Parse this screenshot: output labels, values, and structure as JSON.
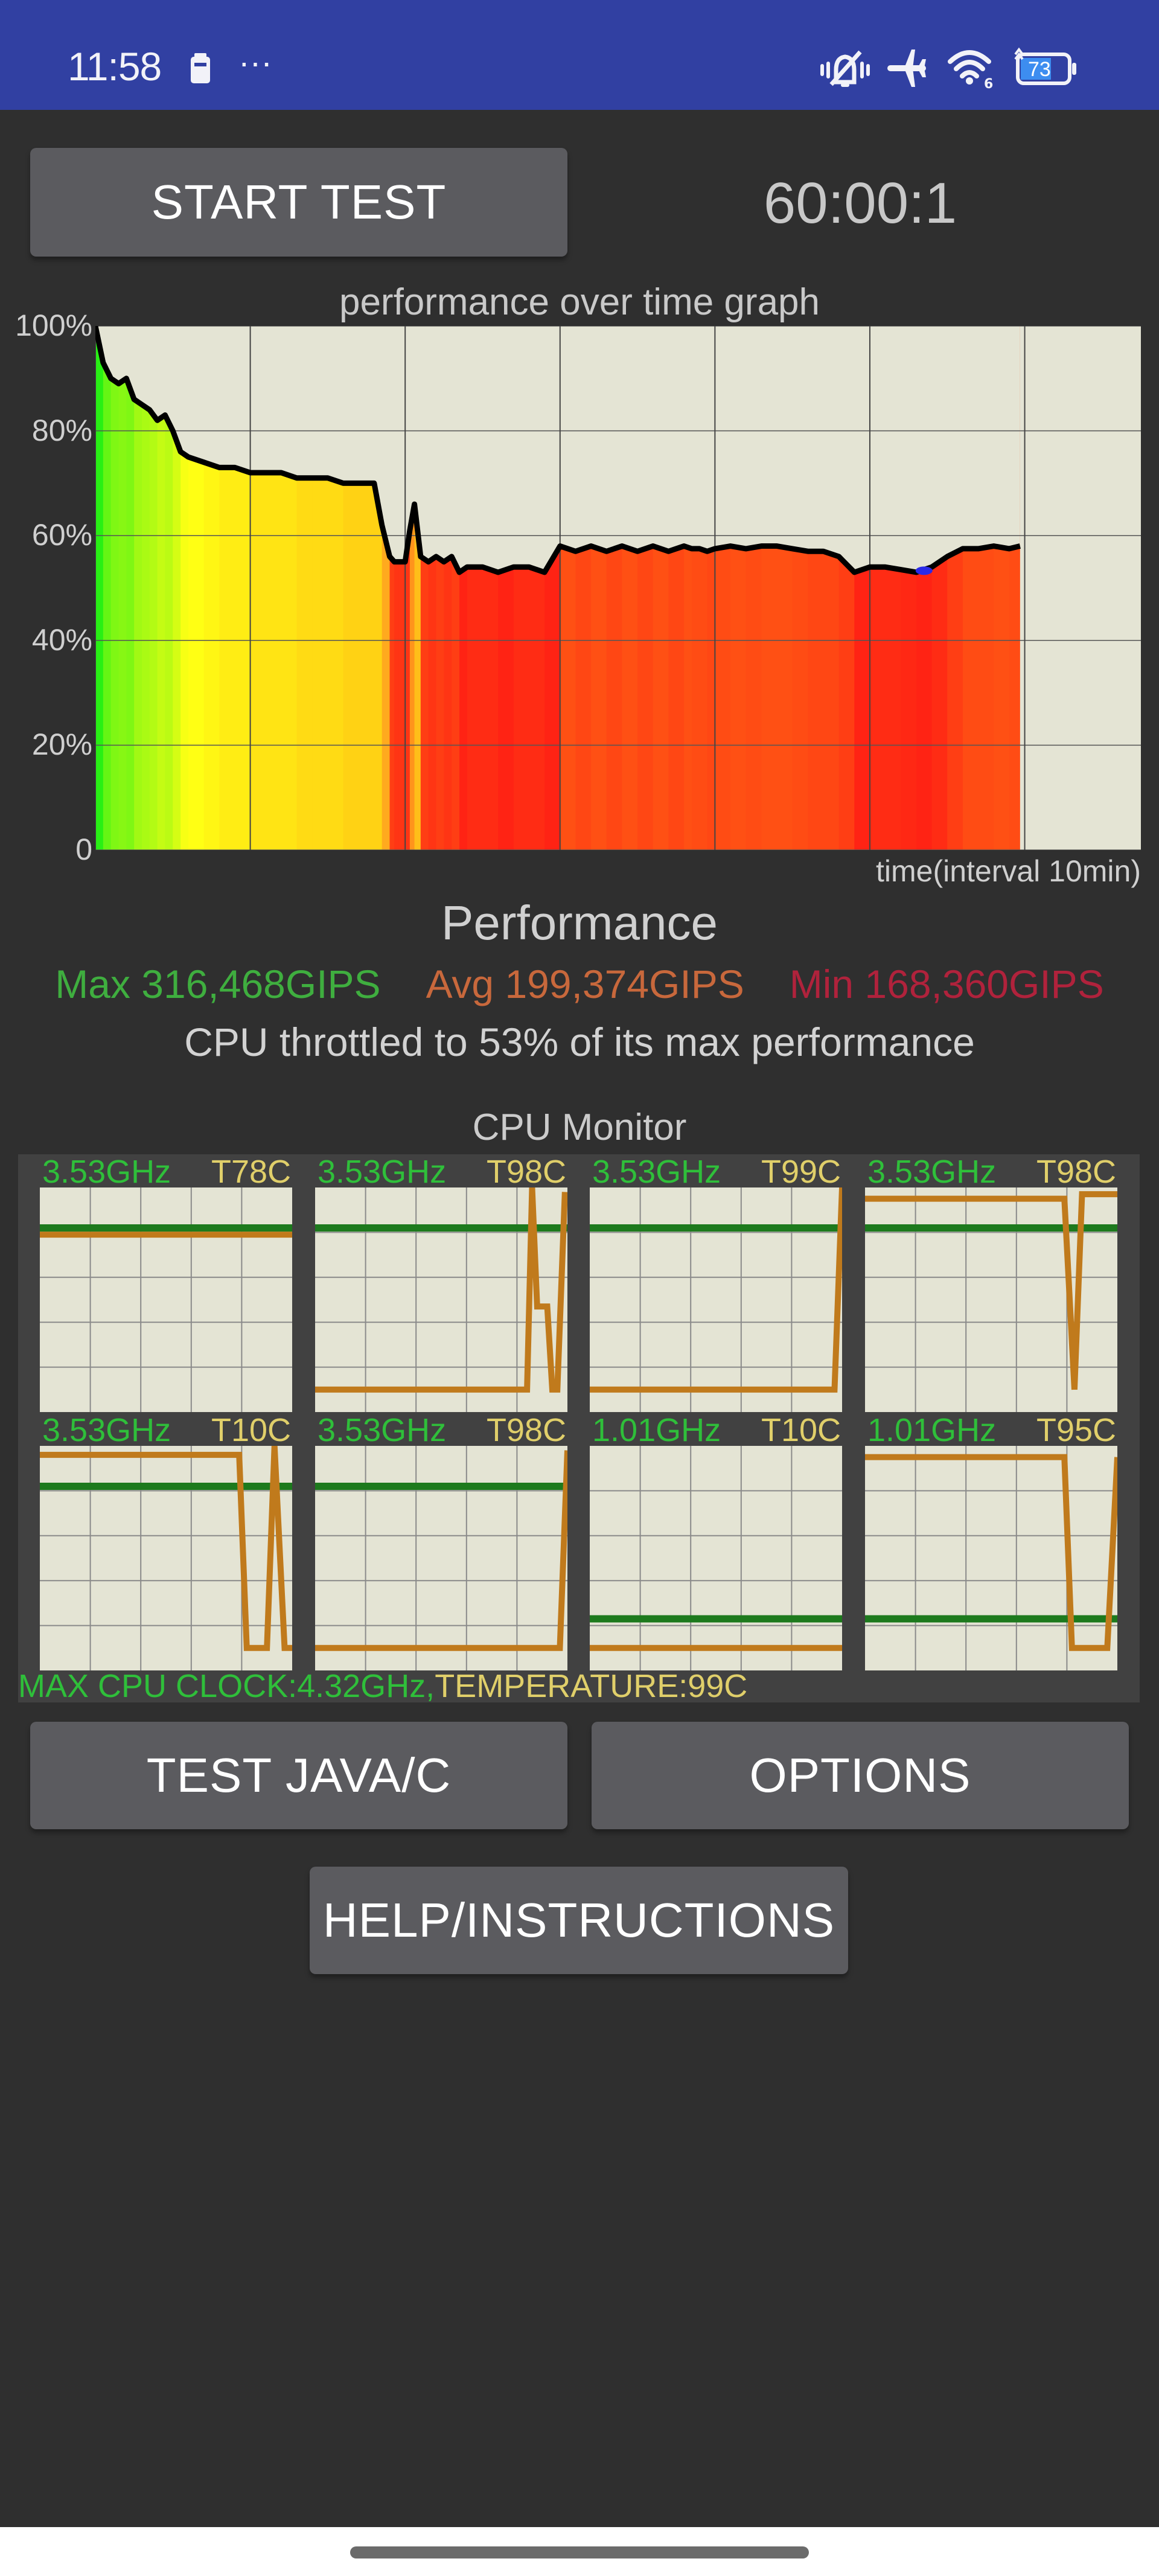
{
  "status_bar": {
    "time": "11:58",
    "icons": [
      "sim-card-icon",
      "more-dots-icon",
      "vibrate-silent-icon",
      "airplane-mode-icon",
      "wifi-6-icon",
      "battery-charging-icon"
    ],
    "more_dots": "···",
    "wifi_badge": "6",
    "battery_level": "73"
  },
  "controls": {
    "start_test_label": "START TEST",
    "timer": "60:00:1",
    "test_java_c_label": "TEST JAVA/C",
    "options_label": "OPTIONS",
    "help_label": "HELP/INSTRUCTIONS"
  },
  "performance": {
    "title": "Performance",
    "max_label": "Max 316,468GIPS",
    "avg_label": "Avg 199,374GIPS",
    "min_label": "Min 168,360GIPS",
    "throttle_text": "CPU throttled to 53% of its max performance",
    "colors": {
      "max": "#3fae3f",
      "avg": "#c8683c",
      "min": "#b0223c"
    }
  },
  "chart_data": [
    {
      "type": "area",
      "title": "performance over time graph",
      "xlabel": "time(interval 10min)",
      "ylabel": "",
      "ylim": [
        0,
        100
      ],
      "xlim": [
        0,
        67.5
      ],
      "y_ticks": [
        "0",
        "20%",
        "40%",
        "60%",
        "80%",
        "100%"
      ],
      "y_tick_values": [
        0,
        20,
        40,
        60,
        80,
        100
      ],
      "x_gridlines_minutes": [
        0,
        10,
        20,
        30,
        40,
        50,
        60
      ],
      "grid": true,
      "x_unit": "minutes",
      "series": [
        {
          "name": "performance %",
          "x": [
            0,
            0.5,
            1,
            1.5,
            2,
            2.5,
            3,
            3.5,
            4,
            4.5,
            5,
            5.5,
            6,
            7,
            8,
            9,
            10,
            11,
            12,
            13,
            14,
            15,
            16,
            17,
            18,
            18.5,
            19,
            19.3,
            19.6,
            20,
            20.3,
            20.6,
            21,
            21.5,
            22,
            22.5,
            23,
            23.5,
            24,
            25,
            26,
            27,
            28,
            29,
            30,
            31,
            32,
            33,
            34,
            35,
            36,
            37,
            38,
            38.5,
            39,
            39.5,
            40,
            41,
            42,
            43,
            44,
            45,
            46,
            47,
            48,
            49,
            50,
            51,
            52,
            53,
            54,
            55,
            56,
            57,
            58,
            59,
            59.7
          ],
          "values": [
            100,
            93,
            90,
            89,
            90,
            86,
            85,
            84,
            82,
            83,
            80,
            76,
            75,
            74,
            73,
            73,
            72,
            72,
            72,
            71,
            71,
            71,
            70,
            70,
            70,
            62,
            56,
            55,
            55,
            55,
            61,
            66,
            56,
            55,
            56,
            55,
            56,
            53,
            54,
            54,
            53,
            54,
            54,
            53,
            58,
            57,
            58,
            57,
            58,
            57,
            58,
            57,
            58,
            57.5,
            57.5,
            57,
            57.5,
            58,
            57.5,
            58,
            58,
            57.5,
            57,
            57,
            56,
            53,
            54,
            54,
            53.5,
            53,
            54,
            56,
            57.5,
            57.5,
            58,
            57.5,
            58
          ]
        }
      ],
      "annotation": "blue marker at minimum near 53.5 min"
    },
    {
      "type": "line",
      "title": "CPU Monitor",
      "footer_max_clock": "MAX CPU CLOCK:4.32GHz,",
      "footer_temperature": "TEMPERATURE:99C",
      "colors": {
        "frequency_line": "#1d7a1d",
        "temperature_line": "#c07a1c",
        "ghz_text": "#2fbf3a",
        "temp_text": "#e0cf6a"
      },
      "cores": [
        {
          "freq_label": "3.53GHz",
          "temp_label": "T78C",
          "freq_fraction": 0.82,
          "temp_trace": [
            [
              0,
              0.79
            ],
            [
              1,
              0.79
            ]
          ]
        },
        {
          "freq_label": "3.53GHz",
          "temp_label": "T98C",
          "freq_fraction": 0.82,
          "temp_trace": [
            [
              0,
              0.1
            ],
            [
              0.84,
              0.1
            ],
            [
              0.86,
              1.0
            ],
            [
              0.88,
              0.47
            ],
            [
              0.92,
              0.47
            ],
            [
              0.94,
              0.1
            ],
            [
              0.96,
              0.1
            ],
            [
              0.99,
              0.98
            ]
          ]
        },
        {
          "freq_label": "3.53GHz",
          "temp_label": "T99C",
          "freq_fraction": 0.82,
          "temp_trace": [
            [
              0,
              0.1
            ],
            [
              0.97,
              0.1
            ],
            [
              1.0,
              1.0
            ]
          ]
        },
        {
          "freq_label": "3.53GHz",
          "temp_label": "T98C",
          "freq_fraction": 0.82,
          "temp_trace": [
            [
              0,
              0.95
            ],
            [
              0.79,
              0.95
            ],
            [
              0.83,
              0.1
            ],
            [
              0.86,
              0.97
            ],
            [
              0.9,
              0.97
            ],
            [
              1,
              0.97
            ]
          ]
        },
        {
          "freq_label": "3.53GHz",
          "temp_label": "T10C",
          "freq_fraction": 0.82,
          "temp_trace": [
            [
              0,
              0.96
            ],
            [
              0.79,
              0.96
            ],
            [
              0.82,
              0.1
            ],
            [
              0.9,
              0.1
            ],
            [
              0.93,
              1.0
            ],
            [
              0.97,
              0.1
            ],
            [
              1,
              0.1
            ]
          ]
        },
        {
          "freq_label": "3.53GHz",
          "temp_label": "T98C",
          "freq_fraction": 0.82,
          "temp_trace": [
            [
              0,
              0.1
            ],
            [
              0.97,
              0.1
            ],
            [
              1.0,
              0.98
            ]
          ]
        },
        {
          "freq_label": "1.01GHz",
          "temp_label": "T10C",
          "freq_fraction": 0.23,
          "temp_trace": [
            [
              0,
              0.1
            ],
            [
              1,
              0.1
            ]
          ]
        },
        {
          "freq_label": "1.01GHz",
          "temp_label": "T95C",
          "freq_fraction": 0.23,
          "temp_trace": [
            [
              0,
              0.95
            ],
            [
              0.79,
              0.95
            ],
            [
              0.82,
              0.1
            ],
            [
              0.96,
              0.1
            ],
            [
              1.0,
              0.95
            ]
          ]
        }
      ]
    }
  ]
}
